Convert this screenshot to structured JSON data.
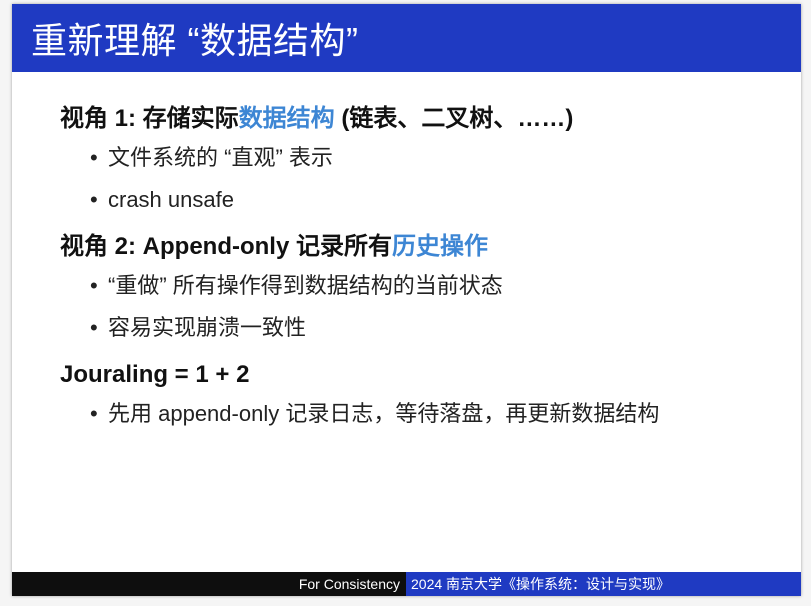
{
  "slide": {
    "title": "重新理解 “数据结构”",
    "sections": [
      {
        "heading_prefix": "视角 1: 存储实际",
        "heading_highlight": "数据结构",
        "heading_suffix": " (链表、二叉树、……)",
        "bullets": [
          "文件系统的 “直观” 表示",
          "crash unsafe"
        ]
      },
      {
        "heading_prefix": "视角 2: Append-only 记录所有",
        "heading_highlight": "历史操作",
        "heading_suffix": "",
        "bullets": [
          "“重做” 所有操作得到数据结构的当前状态",
          "容易实现崩溃一致性"
        ]
      },
      {
        "heading_prefix": "Jouraling = 1 + 2",
        "heading_highlight": "",
        "heading_suffix": "",
        "bullets": [
          "先用 append-only 记录日志，等待落盘，再更新数据结构"
        ]
      }
    ],
    "bullet_symbol": "•",
    "footer": {
      "left": "For Consistency",
      "right": "2024 南京大学《操作系统：设计与实现》"
    }
  },
  "colors": {
    "title_bar": "#1f3ac2",
    "highlight": "#3d86d4",
    "footer_left": "#0e0e0e",
    "footer_right": "#1f3ac2"
  }
}
